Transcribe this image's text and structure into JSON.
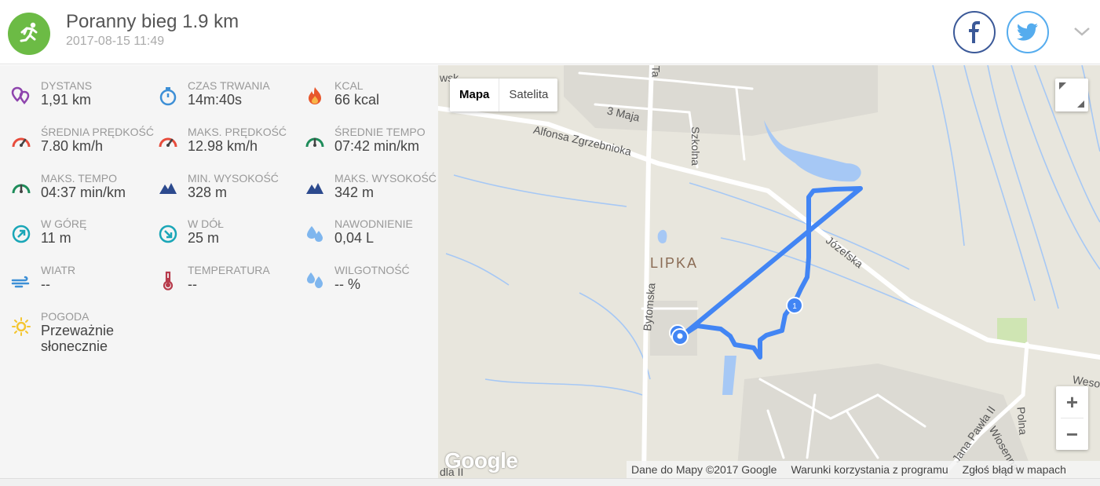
{
  "header": {
    "title": "Poranny bieg 1.9 km",
    "date": "2017-08-15 11:49",
    "colors": {
      "sport": "#6cbb45",
      "facebook": "#3b5998",
      "twitter": "#55acee"
    }
  },
  "stats": [
    {
      "label": "DYSTANS",
      "value": "1,91 km",
      "icon": "distance-icon"
    },
    {
      "label": "CZAS TRWANIA",
      "value": "14m:40s",
      "icon": "stopwatch-icon"
    },
    {
      "label": "KCAL",
      "value": "66 kcal",
      "icon": "flame-icon"
    },
    {
      "label": "ŚREDNIA PRĘDKOŚĆ",
      "value": "7.80 km/h",
      "icon": "speedometer-icon"
    },
    {
      "label": "MAKS. PRĘDKOŚĆ",
      "value": "12.98 km/h",
      "icon": "speedometer-icon"
    },
    {
      "label": "ŚREDNIE TEMPO",
      "value": "07:42 min/km",
      "icon": "pace-gauge-icon"
    },
    {
      "label": "MAKS. TEMPO",
      "value": "04:37 min/km",
      "icon": "pace-gauge-icon"
    },
    {
      "label": "MIN. WYSOKOŚĆ",
      "value": "328 m",
      "icon": "mountain-icon"
    },
    {
      "label": "MAKS. WYSOKOŚĆ",
      "value": "342 m",
      "icon": "mountain-icon"
    },
    {
      "label": "W GÓRĘ",
      "value": "11 m",
      "icon": "arrow-up-circle-icon"
    },
    {
      "label": "W DÓŁ",
      "value": "25 m",
      "icon": "arrow-down-circle-icon"
    },
    {
      "label": "NAWODNIENIE",
      "value": "0,04 L",
      "icon": "water-drops-icon"
    },
    {
      "label": "WIATR",
      "value": "--",
      "icon": "wind-icon"
    },
    {
      "label": "TEMPERATURA",
      "value": "--",
      "icon": "thermometer-icon"
    },
    {
      "label": "WILGOTNOŚĆ",
      "value": "-- %",
      "icon": "humidity-icon"
    },
    {
      "label": "POGODA",
      "value": "Przeważnie",
      "value2": "słonecznie",
      "icon": "sun-icon"
    }
  ],
  "map": {
    "type_buttons": [
      "Mapa",
      "Satelita"
    ],
    "zoom_in": "+",
    "zoom_out": "−",
    "logo": "Google",
    "footer": [
      "Dane do Mapy ©2017 Google",
      "Warunki korzystania z programu",
      "Zgłoś błąd w mapach"
    ],
    "place_label": "LIPKA",
    "street_labels": [
      "3 Maja",
      "Alfonsa Zgrzebnioka",
      "Szkolna",
      "Józefska",
      "Bytomska",
      "Jana Pawła II",
      "Polna",
      "Wiosenna",
      "Weso",
      "Ta",
      "wsk",
      "dla II"
    ],
    "route_marker": "1",
    "route_color": "#4285f4"
  }
}
